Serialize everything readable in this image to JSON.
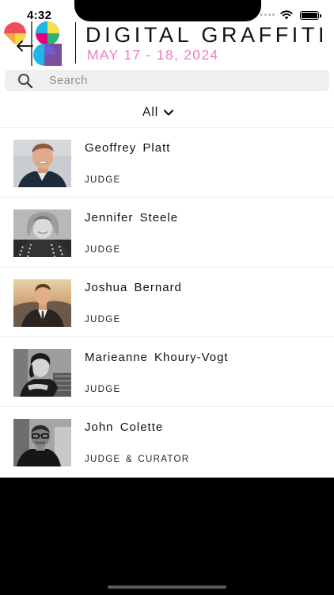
{
  "status_bar": {
    "time": "4:32"
  },
  "header": {
    "title": "DIGITAL GRAFFITI",
    "dates": "MAY 17 - 18, 2024",
    "back_icon": "back-arrow-icon",
    "logo_colors": [
      "#f04e5b",
      "#f4a639",
      "#e6007e",
      "#f6e04c",
      "#1fb6e6",
      "#7a4fa0"
    ],
    "accent_color": "#e97fc1"
  },
  "search": {
    "placeholder": "Search",
    "value": ""
  },
  "filter": {
    "label": "All",
    "icon": "chevron-down-icon"
  },
  "people": [
    {
      "name": "Geoffrey  Platt",
      "role": "JUDGE"
    },
    {
      "name": "Jennifer Steele",
      "role": "JUDGE"
    },
    {
      "name": "Joshua  Bernard",
      "role": "JUDGE"
    },
    {
      "name": "Marieanne  Khoury-Vogt",
      "role": "JUDGE"
    },
    {
      "name": "John  Colette",
      "role": "JUDGE & CURATOR"
    }
  ]
}
